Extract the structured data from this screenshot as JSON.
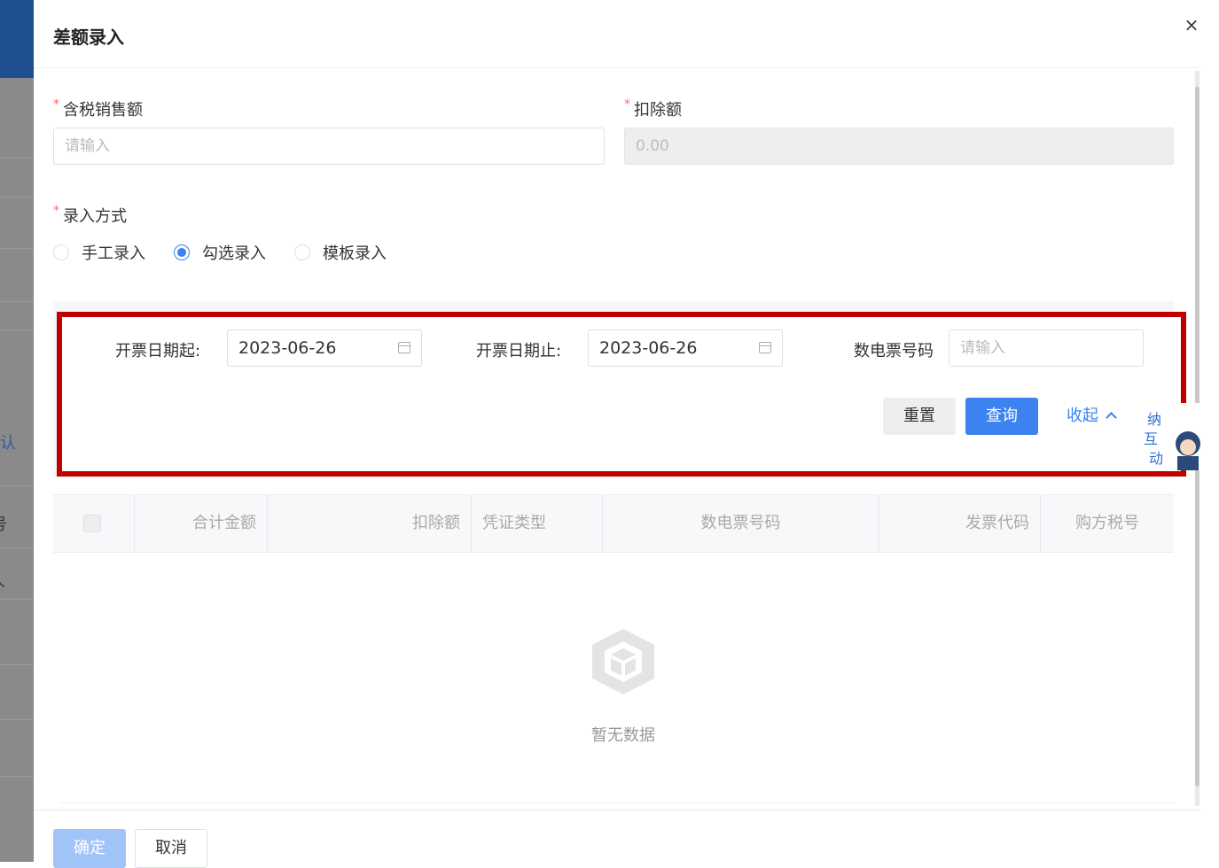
{
  "background": {
    "fragments": [
      "认",
      "号",
      "人"
    ]
  },
  "dialog": {
    "title": "差额录入",
    "close_icon": "×",
    "required_mark": "*",
    "fields": {
      "sales": {
        "label": "含税销售额",
        "placeholder": "请输入"
      },
      "deduction": {
        "label": "扣除额",
        "value": "0.00"
      }
    },
    "entry_mode": {
      "label": "录入方式",
      "options": [
        "手工录入",
        "勾选录入",
        "模板录入"
      ],
      "selected": "勾选录入"
    },
    "filter": {
      "start_label": "开票日期起:",
      "start_value": "2023-06-26",
      "end_label": "开票日期止:",
      "end_value": "2023-06-26",
      "invoice_no_label": "数电票号码",
      "invoice_no_placeholder": "请输入",
      "reset_label": "重置",
      "query_label": "查询",
      "collapse_label": "收起",
      "mascot_text": "纳互动"
    },
    "table": {
      "columns": [
        "合计金额",
        "扣除额",
        "凭证类型",
        "数电票号码",
        "发票代码",
        "购方税号"
      ],
      "empty_text": "暂无数据"
    },
    "footer": {
      "ok_label": "确定",
      "cancel_label": "取消"
    }
  },
  "colors": {
    "primary": "#3c82f0",
    "highlight_border": "#c00000",
    "required": "#f56c6c"
  }
}
